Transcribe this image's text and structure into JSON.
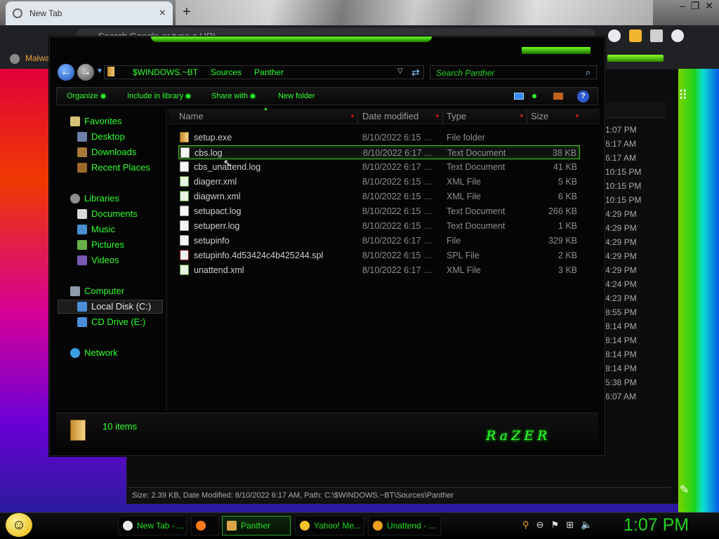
{
  "browser": {
    "tab_title": "New Tab",
    "omnibox_placeholder": "Search Google or type a URL",
    "bookmark_label": "Malwa"
  },
  "explorer": {
    "address_crumbs": [
      "$WINDOWS.~BT",
      "Sources",
      "Panther"
    ],
    "search_placeholder": "Search Panther",
    "toolbar": {
      "organize": "Organize",
      "include": "Include in library",
      "share": "Share with",
      "new_folder": "New folder",
      "help": "?"
    },
    "nav": {
      "favorites": "Favorites",
      "desktop": "Desktop",
      "downloads": "Downloads",
      "recent": "Recent Places",
      "libraries": "Libraries",
      "documents": "Documents",
      "music": "Music",
      "pictures": "Pictures",
      "videos": "Videos",
      "computer": "Computer",
      "local_disk": "Local Disk (C:)",
      "cd_drive": "CD Drive (E:)",
      "network": "Network"
    },
    "columns": {
      "name": "Name",
      "date": "Date modified",
      "type": "Type",
      "size": "Size"
    },
    "files": [
      {
        "name": "setup.exe",
        "date": "8/10/2022 6:15 …",
        "type": "File folder",
        "size": "",
        "icon": "folder"
      },
      {
        "name": "cbs.log",
        "date": "8/10/2022 6:17 …",
        "type": "Text Document",
        "size": "38 KB",
        "icon": "text"
      },
      {
        "name": "cbs_unattend.log",
        "date": "8/10/2022 6:17 …",
        "type": "Text Document",
        "size": "41 KB",
        "icon": "text"
      },
      {
        "name": "diagerr.xml",
        "date": "8/10/2022 6:15 …",
        "type": "XML File",
        "size": "5 KB",
        "icon": "xml"
      },
      {
        "name": "diagwrn.xml",
        "date": "8/10/2022 6:15 …",
        "type": "XML File",
        "size": "6 KB",
        "icon": "xml"
      },
      {
        "name": "setupact.log",
        "date": "8/10/2022 6:15 …",
        "type": "Text Document",
        "size": "266 KB",
        "icon": "text"
      },
      {
        "name": "setuperr.log",
        "date": "8/10/2022 6:15 …",
        "type": "Text Document",
        "size": "1 KB",
        "icon": "text"
      },
      {
        "name": "setupinfo",
        "date": "8/10/2022 6:17 …",
        "type": "File",
        "size": "329 KB",
        "icon": "text"
      },
      {
        "name": "setupinfo.4d53424c4b425244.spl",
        "date": "8/10/2022 6:15 …",
        "type": "SPL File",
        "size": "2 KB",
        "icon": "spl"
      },
      {
        "name": "unattend.xml",
        "date": "8/10/2022 6:17 …",
        "type": "XML File",
        "size": "3 KB",
        "icon": "xml"
      }
    ],
    "selected_file": "cbs.log",
    "item_count": "10 items",
    "brand": "RaZER"
  },
  "background_window": {
    "times": [
      "1:07 PM",
      "6:17 AM",
      "6:17 AM",
      "10:15 PM",
      "10:15 PM",
      "10:15 PM",
      "4:29 PM",
      "4:29 PM",
      "4:29 PM",
      "4:29 PM",
      "4:29 PM",
      "4:24 PM",
      "4:23 PM",
      "8:55 PM",
      "8:14 PM",
      "8:14 PM",
      "8:14 PM",
      "8:14 PM",
      "5:38 PM",
      "6:07 AM"
    ],
    "status": "Size: 2.39 KB, Date Modified: 8/10/2022 6:17 AM, Path: C:\\$WINDOWS.~BT\\Sources\\Panther"
  },
  "taskbar": {
    "tasks": [
      "New Tab - ...",
      "",
      "Panther",
      "Yahoo! Me...",
      "Unattend - ..."
    ],
    "clock": "1:07 PM"
  },
  "colors": {
    "accent_green": "#2cff2c",
    "selection_border": "#4cbf2a",
    "column_arrow": "#d01818"
  }
}
